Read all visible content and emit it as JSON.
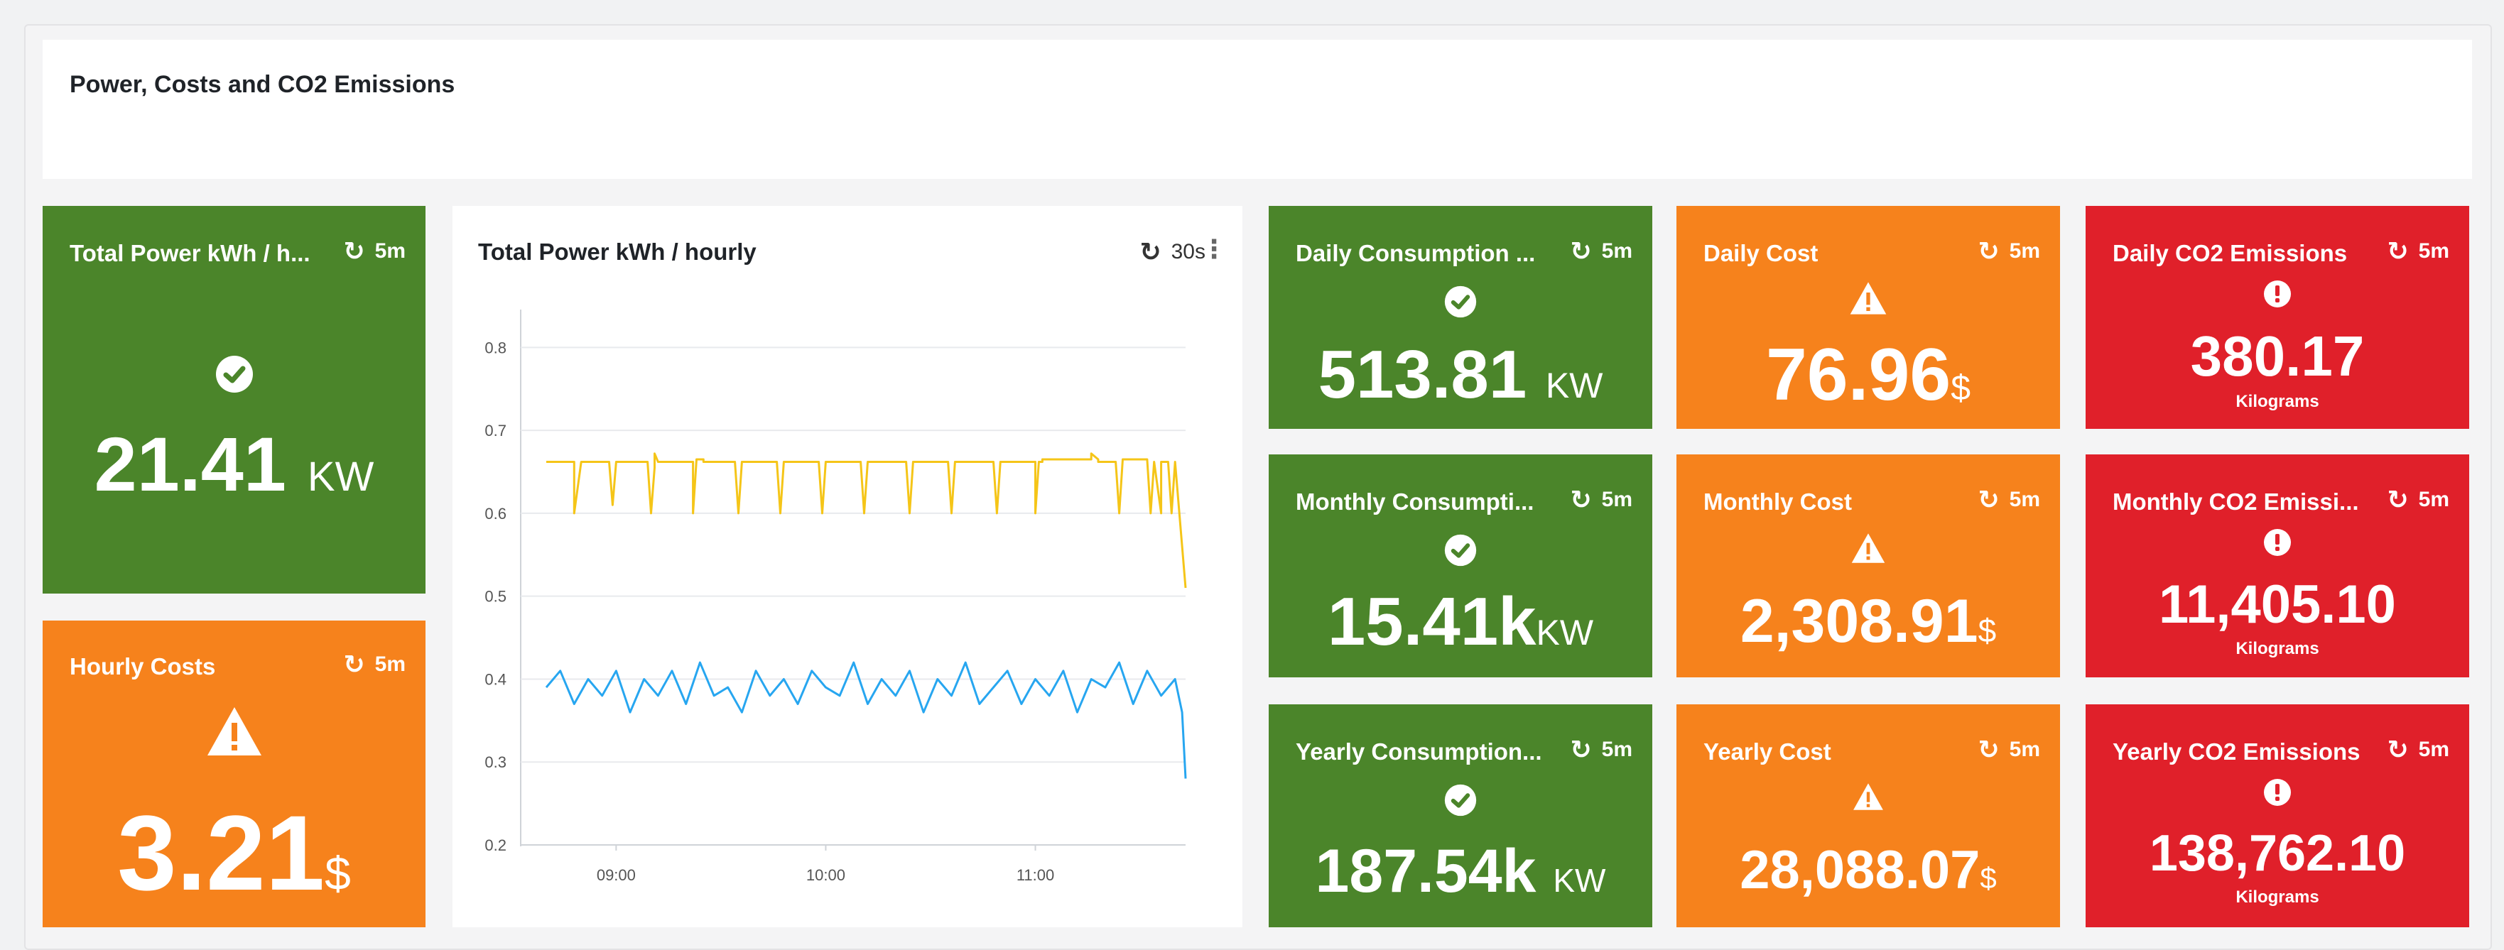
{
  "header": {
    "title": "Power, Costs and CO2 Emissions"
  },
  "colors": {
    "green": "#4b852a",
    "orange": "#f6821c",
    "red": "#e0202a",
    "series_yellow": "#f5c518",
    "series_blue": "#27a6f0"
  },
  "tiles": {
    "total_power": {
      "title": "Total Power kWh / h...",
      "refresh": "5m",
      "icon": "check-circle-icon",
      "value": "21.41",
      "unit": "KW"
    },
    "hourly_costs": {
      "title": "Hourly Costs",
      "refresh": "5m",
      "icon": "warning-triangle-icon",
      "value": "3.21",
      "unit": "$"
    },
    "daily_consumption": {
      "title": "Daily Consumption ...",
      "refresh": "5m",
      "icon": "check-circle-icon",
      "value": "513.81",
      "unit": "KW"
    },
    "monthly_consumption": {
      "title": "Monthly Consumpti...",
      "refresh": "5m",
      "icon": "check-circle-icon",
      "value": "15.41k",
      "unit": "KW"
    },
    "yearly_consumption": {
      "title": "Yearly Consumption...",
      "refresh": "5m",
      "icon": "check-circle-icon",
      "value": "187.54k",
      "unit": "KW"
    },
    "daily_cost": {
      "title": "Daily Cost",
      "refresh": "5m",
      "icon": "warning-triangle-icon",
      "value": "76.96",
      "unit": "$"
    },
    "monthly_cost": {
      "title": "Monthly Cost",
      "refresh": "5m",
      "icon": "warning-triangle-icon",
      "value": "2,308.91",
      "unit": "$"
    },
    "yearly_cost": {
      "title": "Yearly Cost",
      "refresh": "5m",
      "icon": "warning-triangle-icon",
      "value": "28,088.07",
      "unit": "$"
    },
    "daily_co2": {
      "title": "Daily CO2 Emissions",
      "refresh": "5m",
      "icon": "alert-circle-icon",
      "value": "380.17",
      "unit": "Kilograms"
    },
    "monthly_co2": {
      "title": "Monthly CO2 Emissi...",
      "refresh": "5m",
      "icon": "alert-circle-icon",
      "value": "11,405.10",
      "unit": "Kilograms"
    },
    "yearly_co2": {
      "title": "Yearly CO2 Emissions",
      "refresh": "5m",
      "icon": "alert-circle-icon",
      "value": "138,762.10",
      "unit": "Kilograms"
    }
  },
  "chart_panel": {
    "title": "Total Power kWh / hourly",
    "refresh": "30s"
  },
  "chart_data": {
    "type": "line",
    "title": "Total Power kWh / hourly",
    "xlabel": "",
    "ylabel": "",
    "x_ticks": [
      "09:00",
      "10:00",
      "11:00"
    ],
    "y_ticks": [
      0.2,
      0.3,
      0.4,
      0.5,
      0.6,
      0.7,
      0.8
    ],
    "ylim": [
      0.2,
      0.82
    ],
    "xlim": [
      "08:40",
      "11:43"
    ],
    "grid": true,
    "legend": "none",
    "series": [
      {
        "color": "#f5c518",
        "x": [
          "08:40",
          "08:48",
          "08:48",
          "08:50",
          "08:50",
          "08:58",
          "08:59",
          "09:00",
          "09:00",
          "09:09",
          "09:10",
          "09:11",
          "09:11",
          "09:12",
          "09:13",
          "09:14",
          "09:22",
          "09:22",
          "09:23",
          "09:23",
          "09:25",
          "09:25",
          "09:34",
          "09:35",
          "09:36",
          "09:36",
          "09:46",
          "09:47",
          "09:48",
          "09:48",
          "09:58",
          "09:59",
          "10:00",
          "10:00",
          "10:10",
          "10:11",
          "10:12",
          "10:12",
          "10:23",
          "10:24",
          "10:25",
          "10:25",
          "10:35",
          "10:36",
          "10:37",
          "10:37",
          "10:48",
          "10:49",
          "10:50",
          "10:50",
          "11:00",
          "11:00",
          "11:01",
          "11:01",
          "11:02",
          "11:02",
          "11:16",
          "11:16",
          "11:18",
          "11:18",
          "11:23",
          "11:24",
          "11:25",
          "11:25",
          "11:32",
          "11:33",
          "11:34",
          "11:34",
          "11:36",
          "11:36",
          "11:38",
          "11:39",
          "11:40",
          "11:40",
          "11:43"
        ],
        "y": [
          0.662,
          0.662,
          0.6,
          0.662,
          0.662,
          0.662,
          0.61,
          0.662,
          0.662,
          0.662,
          0.6,
          0.655,
          0.672,
          0.662,
          0.662,
          0.662,
          0.662,
          0.6,
          0.665,
          0.665,
          0.665,
          0.662,
          0.662,
          0.6,
          0.662,
          0.662,
          0.662,
          0.6,
          0.662,
          0.662,
          0.662,
          0.6,
          0.662,
          0.662,
          0.662,
          0.6,
          0.662,
          0.662,
          0.662,
          0.6,
          0.662,
          0.662,
          0.662,
          0.6,
          0.662,
          0.662,
          0.662,
          0.6,
          0.662,
          0.662,
          0.662,
          0.6,
          0.662,
          0.662,
          0.662,
          0.665,
          0.665,
          0.672,
          0.665,
          0.662,
          0.662,
          0.6,
          0.665,
          0.665,
          0.665,
          0.6,
          0.662,
          0.662,
          0.6,
          0.662,
          0.662,
          0.6,
          0.662,
          0.662,
          0.51
        ]
      },
      {
        "color": "#27a6f0",
        "x": [
          "08:40",
          "08:44",
          "08:48",
          "08:52",
          "08:56",
          "09:00",
          "09:04",
          "09:08",
          "09:12",
          "09:16",
          "09:20",
          "09:24",
          "09:28",
          "09:32",
          "09:36",
          "09:40",
          "09:44",
          "09:48",
          "09:52",
          "09:56",
          "10:00",
          "10:04",
          "10:08",
          "10:12",
          "10:16",
          "10:20",
          "10:24",
          "10:28",
          "10:32",
          "10:36",
          "10:40",
          "10:44",
          "10:48",
          "10:52",
          "10:56",
          "11:00",
          "11:04",
          "11:08",
          "11:12",
          "11:16",
          "11:20",
          "11:24",
          "11:28",
          "11:32",
          "11:36",
          "11:40",
          "11:42",
          "11:43"
        ],
        "y": [
          0.39,
          0.41,
          0.37,
          0.4,
          0.38,
          0.41,
          0.36,
          0.4,
          0.38,
          0.41,
          0.37,
          0.42,
          0.38,
          0.39,
          0.36,
          0.41,
          0.38,
          0.4,
          0.37,
          0.41,
          0.39,
          0.38,
          0.42,
          0.37,
          0.4,
          0.38,
          0.41,
          0.36,
          0.4,
          0.38,
          0.42,
          0.37,
          0.39,
          0.41,
          0.37,
          0.4,
          0.38,
          0.41,
          0.36,
          0.4,
          0.39,
          0.42,
          0.37,
          0.41,
          0.38,
          0.4,
          0.36,
          0.28
        ]
      }
    ]
  }
}
